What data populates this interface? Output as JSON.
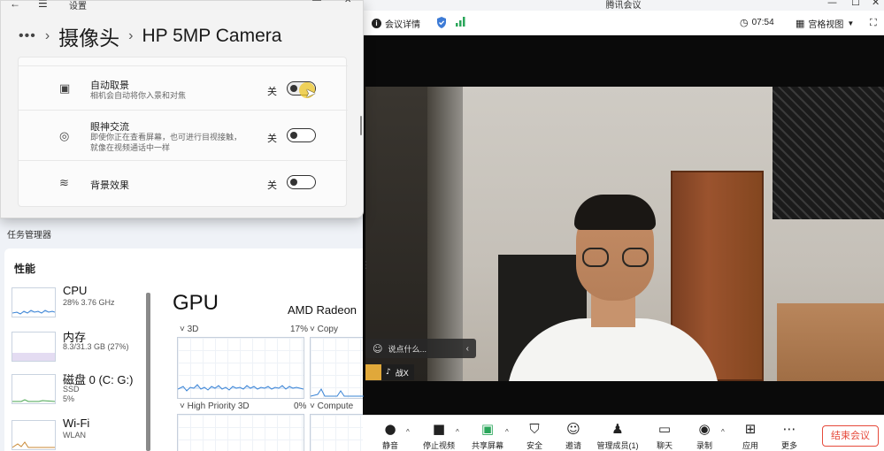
{
  "settings": {
    "title": "设置",
    "breadcrumb": {
      "more": "•••",
      "separator": "›",
      "section": "摄像头",
      "device": "HP 5MP Camera"
    },
    "rows": [
      {
        "label": "自动取景",
        "description": "相机会自动将你入景和对焦",
        "state": "关"
      },
      {
        "label": "眼神交流",
        "description": "即使你正在查看屏幕，也可进行目视接触，就像在视频通话中一样",
        "state": "关"
      },
      {
        "label": "背景效果",
        "description": "",
        "state": "关"
      }
    ]
  },
  "taskmgr": {
    "title": "任务管理器",
    "section": "性能",
    "items": [
      {
        "name": "CPU",
        "detail": "28%  3.76 GHz"
      },
      {
        "name": "内存",
        "detail": "8.3/31.3 GB (27%)"
      },
      {
        "name": "磁盘 0 (C: G:)",
        "detail": "SSD",
        "detail2": "5%"
      },
      {
        "name": "Wi-Fi",
        "detail": "WLAN"
      }
    ],
    "gpu": {
      "title": "GPU",
      "name": "AMD Radeon",
      "graphs": [
        {
          "label": "˅ 3D",
          "value": "17%"
        },
        {
          "label": "˅ Copy",
          "value": ""
        },
        {
          "label": "˅ High Priority 3D",
          "value": "0%"
        },
        {
          "label": "˅ Compute",
          "value": ""
        }
      ]
    }
  },
  "meeting": {
    "app_title": "腾讯会议",
    "info_label": "会议详情",
    "time": "07:54",
    "view_label": "宫格视图",
    "chat_placeholder": "说点什么...",
    "participant_name": "战X",
    "toolbar": [
      {
        "label": "静音",
        "icon": "mic-icon"
      },
      {
        "label": "停止视频",
        "icon": "camera-icon"
      },
      {
        "label": "共享屏幕",
        "icon": "share-screen-icon"
      },
      {
        "label": "安全",
        "icon": "shield-icon"
      },
      {
        "label": "邀请",
        "icon": "invite-icon"
      },
      {
        "label": "管理成员(1)",
        "icon": "members-icon"
      },
      {
        "label": "聊天",
        "icon": "chat-icon"
      },
      {
        "label": "录制",
        "icon": "record-icon"
      },
      {
        "label": "应用",
        "icon": "apps-icon"
      },
      {
        "label": "更多",
        "icon": "more-icon"
      }
    ],
    "end_label": "结束会议"
  }
}
